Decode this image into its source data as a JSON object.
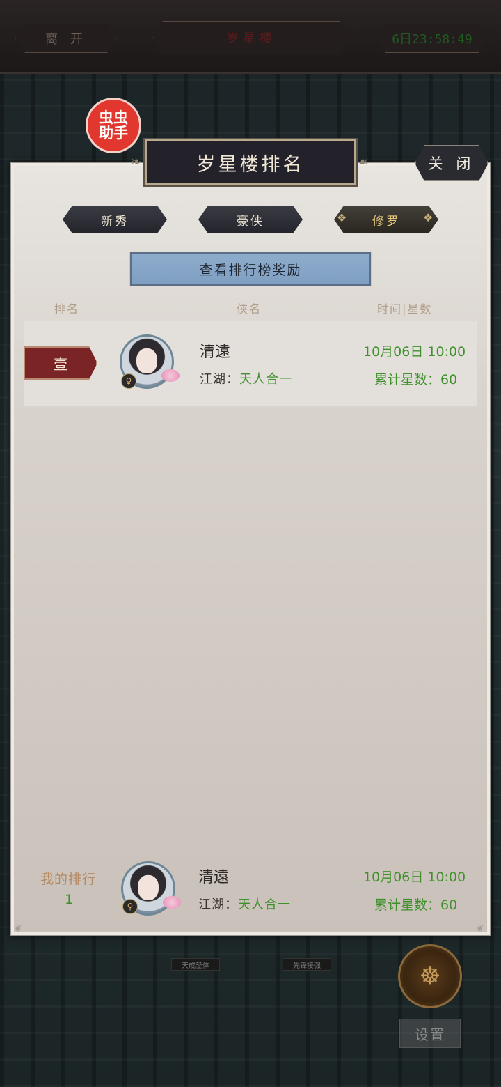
{
  "topbar": {
    "leave_label": "离 开",
    "title": "岁星楼",
    "countdown": "6日23:58:49"
  },
  "badge": {
    "line1": "虫虫",
    "line2": "助手"
  },
  "panel": {
    "title": "岁星楼排名",
    "close_label": "关 闭",
    "tabs": [
      {
        "label": "新秀",
        "active": false
      },
      {
        "label": "豪侠",
        "active": false
      },
      {
        "label": "修罗",
        "active": true
      }
    ],
    "reward_button": "查看排行榜奖励",
    "columns": {
      "rank": "排名",
      "name": "侠名",
      "time_stars": "时间|星数"
    },
    "rows": [
      {
        "rank": "壹",
        "name": "清遠",
        "jianghu_label": "江湖：",
        "jianghu_value": "天人合一",
        "time": "10月06日  10:00",
        "stars_label": "累计星数：",
        "stars": "60"
      }
    ],
    "my_rank": {
      "label": "我的排行",
      "value": "1",
      "name": "清遠",
      "jianghu_label": "江湖：",
      "jianghu_value": "天人合一",
      "time": "10月06日  10:00",
      "stars_label": "累计星数：",
      "stars": "60"
    }
  },
  "bottom": {
    "mini_tab_1": "天成圣体",
    "mini_tab_2": "先锋接强",
    "settings_label": "设置"
  },
  "colors": {
    "accent_green": "#3f8f2b",
    "rank_red": "#7b2425",
    "reward_blue": "#8eaccc"
  }
}
